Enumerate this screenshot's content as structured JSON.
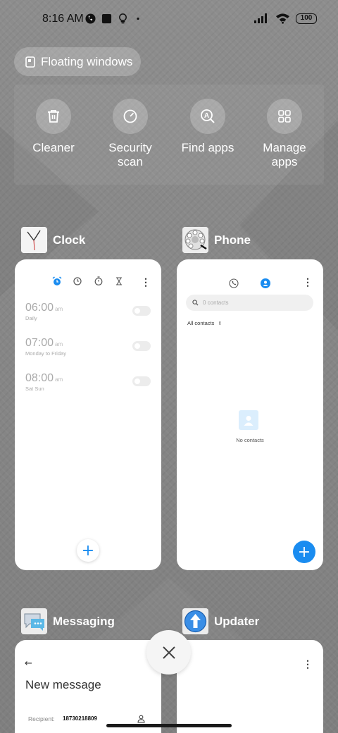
{
  "status_bar": {
    "time": "8:16 AM",
    "battery": "100",
    "icons_left": [
      "whatsapp-icon",
      "square-app-icon",
      "bulb-icon",
      "dot-icon"
    ],
    "icons_right": [
      "signal-icon",
      "wifi-icon",
      "battery-icon"
    ]
  },
  "floating_windows": {
    "label": "Floating windows",
    "icon": "floating-window-icon"
  },
  "quick_actions": [
    {
      "label": "Cleaner",
      "icon": "trash-icon"
    },
    {
      "label": "Security scan",
      "icon": "security-scan-icon"
    },
    {
      "label": "Find apps",
      "icon": "find-apps-icon"
    },
    {
      "label": "Manage apps",
      "icon": "manage-apps-icon"
    }
  ],
  "apps": {
    "clock": {
      "name": "Clock",
      "tabs": [
        "alarm-icon",
        "clock-icon",
        "stopwatch-icon",
        "timer-icon"
      ],
      "alarms": [
        {
          "time": "06:00",
          "ampm": "am",
          "days": "Daily"
        },
        {
          "time": "07:00",
          "ampm": "am",
          "days": "Monday to Friday"
        },
        {
          "time": "08:00",
          "ampm": "am",
          "days": "Sat Sun"
        }
      ],
      "fab": "+"
    },
    "phone": {
      "name": "Phone",
      "search_placeholder": "0 contacts",
      "filter_label": "All contacts",
      "empty_label": "No contacts",
      "fab": "+"
    },
    "messaging": {
      "name": "Messaging",
      "title": "New message",
      "recipient_label": "Recipient:",
      "recipient_value": "18730218809"
    },
    "updater": {
      "name": "Updater"
    }
  },
  "colors": {
    "accent": "#1a8cf0",
    "background": "#8a8a8a"
  }
}
